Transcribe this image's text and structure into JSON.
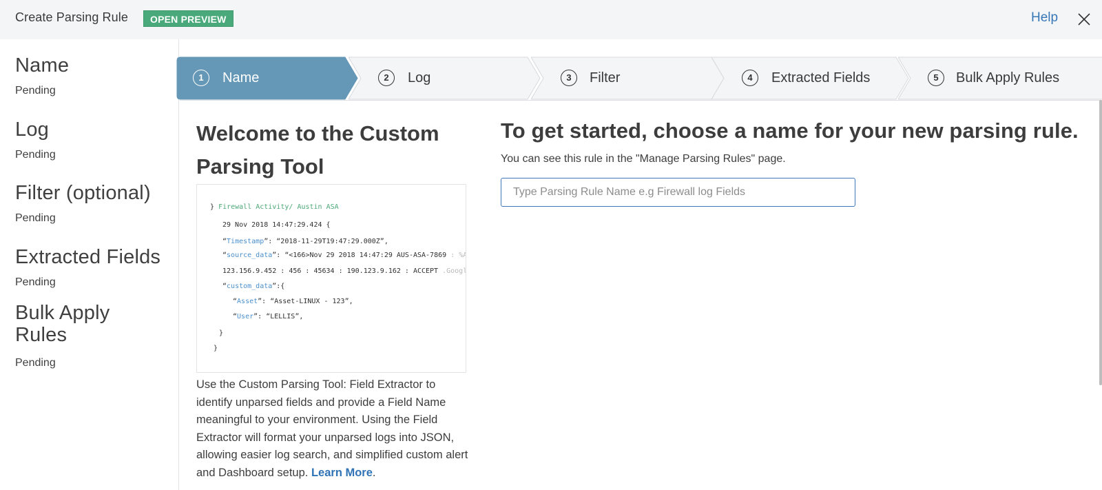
{
  "header": {
    "title": "Create Parsing Rule",
    "badge": "OPEN PREVIEW",
    "help": "Help",
    "close_icon": "close-icon",
    "badge_color": "#49a97a",
    "link_color": "#3777b7"
  },
  "sidebar": {
    "steps": [
      {
        "title": "Name",
        "status": "Pending"
      },
      {
        "title": "Log",
        "status": "Pending"
      },
      {
        "title": "Filter (optional)",
        "status": "Pending"
      },
      {
        "title": "Extracted Fields",
        "status": "Pending"
      },
      {
        "title": "Bulk Apply Rules",
        "status": "Pending"
      }
    ]
  },
  "stepper": {
    "active_color": "#6597b7",
    "steps": [
      {
        "number": "1",
        "label": "Name",
        "active": true
      },
      {
        "number": "2",
        "label": "Log",
        "active": false
      },
      {
        "number": "3",
        "label": "Filter",
        "active": false
      },
      {
        "number": "4",
        "label": "Extracted Fields",
        "active": false
      },
      {
        "number": "5",
        "label": "Bulk Apply Rules",
        "active": false
      }
    ]
  },
  "main": {
    "welcome_title": "Welcome to the Custom Parsing Tool",
    "code_preview": {
      "header_brace": "}",
      "header_text": "Firewall Activity/ Austin ASA",
      "date_line": "29 Nov 2018 14:47:29.424 {",
      "timestamp_key": "Timestamp",
      "timestamp_value": "“2018-11-29T19:47:29.000Z”,",
      "source_key": "source_data",
      "source_value": "“<166>Nov 29 2018 14:47:29 AUS-ASA-7869",
      "source_fade": " : %ASA",
      "ip_line": "123.156.9.452 : 456 : 45634 : 190.123.9.162 : ACCEPT",
      "ip_fade": " .Google",
      "custom_key": "custom_data",
      "custom_open": "”:{",
      "asset_key": "Asset",
      "asset_value": "“Asset-LINUX - 123”,",
      "user_key": "User",
      "user_value": "“LELLIS”,",
      "close_inner": "}",
      "close_outer": "}"
    },
    "description": "Use the Custom Parsing Tool: Field Extractor to identify unparsed fields and provide a Field Name meaningful to your environment. Using the Field Extractor will format your unparsed logs into JSON, allowing easier log search, and simplified custom alert and Dashboard setup.",
    "learn_more": "Learn More",
    "description_end": ".",
    "prompt_title": "To get started, choose a name for your new parsing rule.",
    "prompt_subtitle": "You can see this rule in the \"Manage Parsing Rules\" page.",
    "name_input": {
      "value": "",
      "placeholder": "Type Parsing Rule Name e.g Firewall log Fields"
    }
  }
}
